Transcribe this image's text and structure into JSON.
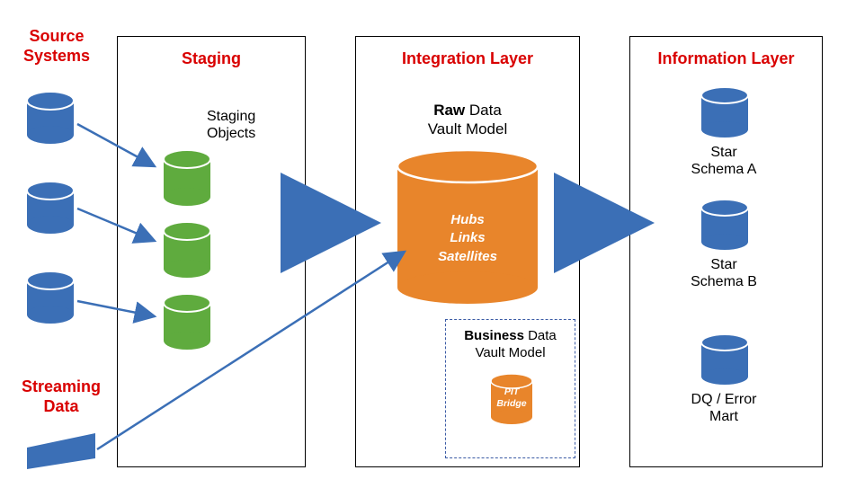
{
  "labels": {
    "source_systems": "Source\nSystems",
    "streaming_data": "Streaming\nData",
    "staging": "Staging",
    "staging_objects": "Staging\nObjects",
    "integration_layer": "Integration Layer",
    "raw_vault_title_bold": "Raw",
    "raw_vault_title_rest": " Data\nVault Model",
    "raw_vault_items": "Hubs\nLinks\nSatellites",
    "business_vault_title_bold": "Business",
    "business_vault_title_rest": " Data\nVault Model",
    "business_vault_items": "PIT\nBridge",
    "information_layer": "Information Layer",
    "star_schema_a": "Star\nSchema A",
    "star_schema_b": "Star\nSchema B",
    "dq_error_mart": "DQ / Error\nMart"
  },
  "colors": {
    "red": "#d90000",
    "blue": "#3b6fb6",
    "blue_dark": "#2c5a9a",
    "green": "#5fab3e",
    "green_dark": "#4a8a2f",
    "orange": "#e8852b",
    "orange_dark": "#c96f1d",
    "arrow_blue": "#3b6fb6",
    "box_border": "#000000",
    "dashed_border": "#3b5ba5"
  }
}
